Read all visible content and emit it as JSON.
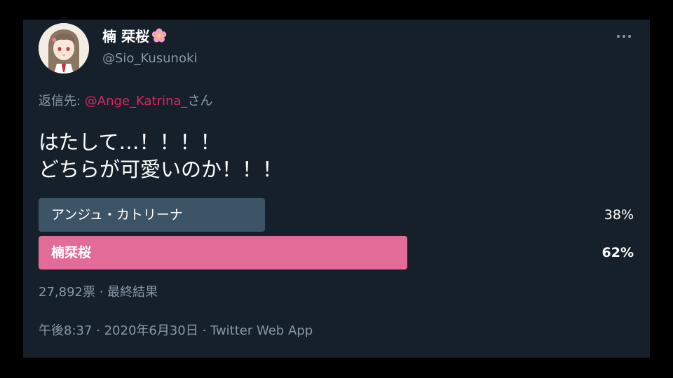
{
  "tweet": {
    "display_name": "楠 栞桜",
    "name_emoji_icon": "cherry-blossom-icon",
    "handle": "@Sio_Kusunoki",
    "reply_prefix": "返信先: ",
    "reply_mention": "@Ange_Katrina_",
    "reply_suffix": "さん",
    "text_line_1": "はたして…！！！！",
    "text_line_2": "どちらが可愛いのか！！！",
    "more_icon": "more-horizontal-icon"
  },
  "poll": {
    "options": [
      {
        "label": "アンジュ・カトリーナ",
        "percent_label": "38%",
        "percent": 38,
        "bar_color": "#3d5466",
        "winner": false
      },
      {
        "label": "楠栞桜",
        "percent_label": "62%",
        "percent": 62,
        "bar_color": "#e26b97",
        "winner": true
      }
    ],
    "votes": "27,892票",
    "separator": " · ",
    "status": "最終結果"
  },
  "meta": {
    "time": "午後8:37",
    "separator_1": " · ",
    "date": "2020年6月30日",
    "separator_2": " · ",
    "source": "Twitter Web App"
  },
  "colors": {
    "background": "#15202b",
    "secondary_text": "#8899a6",
    "mention": "#e0245e"
  }
}
